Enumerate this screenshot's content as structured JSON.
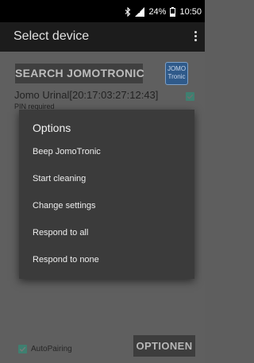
{
  "status_bar": {
    "battery_percent": "24%",
    "time": "10:50",
    "icons": [
      "bluetooth-icon",
      "signal-icon",
      "battery-icon"
    ]
  },
  "app_bar": {
    "title": "Select device",
    "menu_icon": "overflow-menu-icon"
  },
  "main": {
    "search_button_label": "SEARCH JOMOTRONIC",
    "logo_line1": "JOMO",
    "logo_line2": "Tronic",
    "device": {
      "name": "Jomo Urinal[20:17:03:27:12:43]",
      "status": "PIN required",
      "checked": true
    },
    "autopairing": {
      "label": "AutoPairing",
      "checked": true
    },
    "optionen_button_label": "OPTIONEN"
  },
  "dialog": {
    "title": "Options",
    "options": [
      "Beep JomoTronic",
      "Start cleaning",
      "Change settings",
      "Respond to all",
      "Respond to none"
    ]
  },
  "colors": {
    "status_bar": "#000000",
    "app_bar": "#1c1c1c",
    "scrim": "#5f5f5f",
    "dialog": "#3b3b3b",
    "checkbox_accent": "#3f7f70",
    "logo_blue": "#2f5a8a"
  }
}
